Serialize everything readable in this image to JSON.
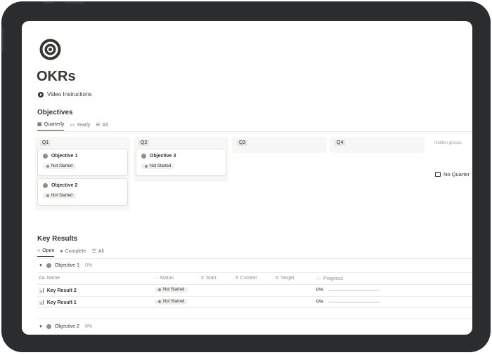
{
  "page": {
    "title": "OKRs",
    "video_instructions_label": "Video Instructions"
  },
  "objectives": {
    "title": "Objectives",
    "views": [
      {
        "label": "Quarterly",
        "icon": "calendar-icon",
        "active": true
      },
      {
        "label": "Yearly",
        "icon": "calendar-icon",
        "active": false
      },
      {
        "label": "All",
        "icon": "list-icon",
        "active": false
      }
    ],
    "columns": [
      {
        "label": "Q1",
        "cards": [
          {
            "title": "Objective 1",
            "status": "Not Started"
          },
          {
            "title": "Objective 2",
            "status": "Not Started"
          }
        ]
      },
      {
        "label": "Q2",
        "cards": [
          {
            "title": "Objective 3",
            "status": "Not Started"
          }
        ]
      },
      {
        "label": "Q3",
        "cards": []
      },
      {
        "label": "Q4",
        "cards": []
      }
    ],
    "hidden_groups_label": "Hidden groups",
    "no_quarter_label": "No Quarter"
  },
  "key_results": {
    "title": "Key Results",
    "views": [
      {
        "label": "Open",
        "icon": "circle-icon",
        "active": true
      },
      {
        "label": "Complete",
        "icon": "check-circle-icon",
        "active": false
      },
      {
        "label": "All",
        "icon": "list-icon",
        "active": false
      }
    ],
    "groups": [
      {
        "name": "Objective 1",
        "percent": "0%"
      },
      {
        "name": "Objective 2",
        "percent": "0%"
      }
    ],
    "columns": {
      "name": "Name",
      "status": "Status",
      "start": "Start",
      "current": "Current",
      "target": "Target",
      "progress": "Progress"
    },
    "rows": [
      {
        "name": "Key Result 2",
        "status": "Not Started",
        "progress": "0%",
        "progress_value": 0
      },
      {
        "name": "Key Result 1",
        "status": "Not Started",
        "progress": "0%",
        "progress_value": 0
      }
    ]
  },
  "colors": {
    "text": "#37352f",
    "muted": "#8f8e8a",
    "board_bg": "#f7f7f5",
    "frame": "#2b2c2d"
  }
}
